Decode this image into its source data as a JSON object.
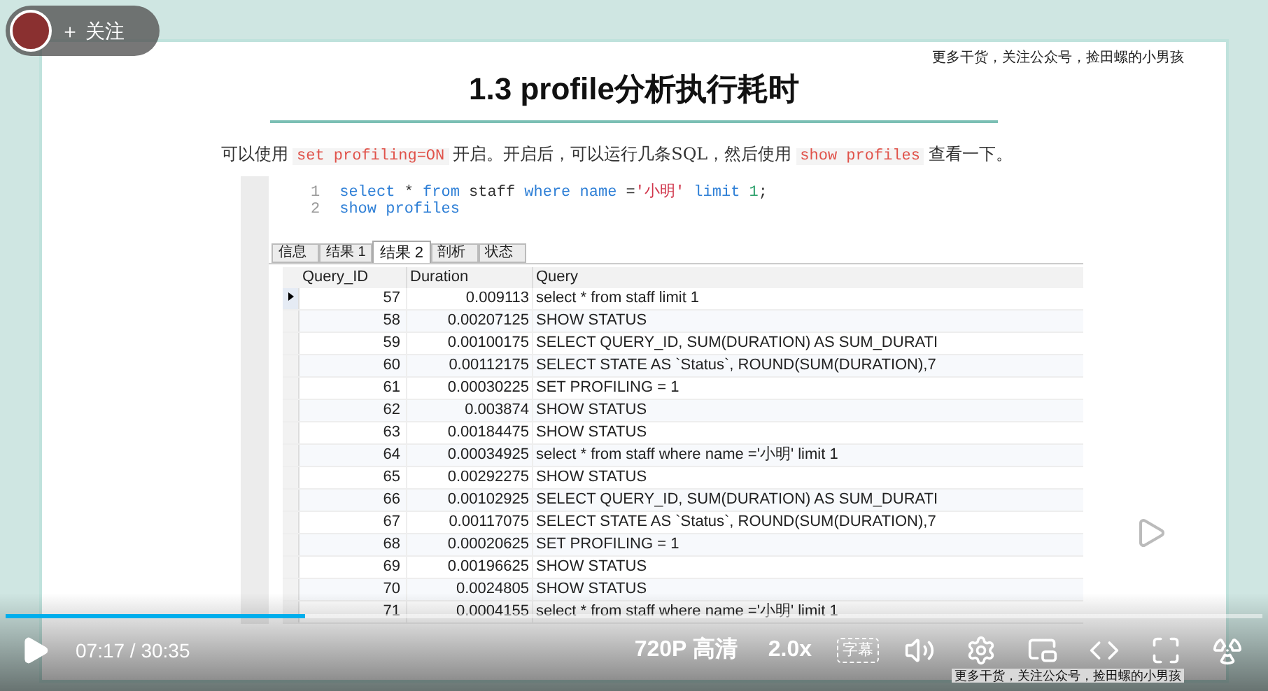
{
  "follow_button": {
    "label": "＋ 关注"
  },
  "slide": {
    "title": "1.3 profile分析执行耗时",
    "header_note": "更多干货，关注公众号，捡田螺的小男孩",
    "paragraph": [
      {
        "kind": "text",
        "text": "可以使用"
      },
      {
        "kind": "code",
        "text": "set profiling=ON"
      },
      {
        "kind": "text",
        "text": "开启。开启后，可以运行几条SQL，然后使用"
      },
      {
        "kind": "code",
        "text": "show profiles"
      },
      {
        "kind": "text",
        "text": "查看一下。"
      }
    ],
    "editor": {
      "lines": [
        {
          "number": "1",
          "tokens": [
            {
              "kind": "keyword",
              "text": "select"
            },
            {
              "kind": "plain",
              "text": " * "
            },
            {
              "kind": "keyword",
              "text": "from"
            },
            {
              "kind": "plain",
              "text": " staff "
            },
            {
              "kind": "keyword",
              "text": "where name"
            },
            {
              "kind": "plain",
              "text": " ="
            },
            {
              "kind": "string",
              "text": "'小明'"
            },
            {
              "kind": "keyword",
              "text": " limit "
            },
            {
              "kind": "number",
              "text": "1"
            },
            {
              "kind": "plain",
              "text": ";"
            }
          ]
        },
        {
          "number": "2",
          "tokens": [
            {
              "kind": "keyword",
              "text": "show profiles"
            }
          ]
        }
      ]
    },
    "tabs": [
      {
        "label": "信息",
        "selected": false
      },
      {
        "label": "结果 1",
        "selected": false
      },
      {
        "label": "结果 2",
        "selected": true
      },
      {
        "label": "剖析",
        "selected": false
      },
      {
        "label": "状态",
        "selected": false
      }
    ],
    "table": {
      "columns": [
        "Query_ID",
        "Duration",
        "Query"
      ],
      "rows": [
        {
          "selected": true,
          "cells": [
            "57",
            "0.009113",
            "select * from staff limit 1"
          ]
        },
        {
          "selected": false,
          "cells": [
            "58",
            "0.00207125",
            "SHOW STATUS"
          ]
        },
        {
          "selected": false,
          "cells": [
            "59",
            "0.00100175",
            "SELECT QUERY_ID, SUM(DURATION) AS SUM_DURATI"
          ]
        },
        {
          "selected": false,
          "cells": [
            "60",
            "0.00112175",
            "SELECT STATE AS `Status`, ROUND(SUM(DURATION),7"
          ]
        },
        {
          "selected": false,
          "cells": [
            "61",
            "0.00030225",
            "SET PROFILING = 1"
          ]
        },
        {
          "selected": false,
          "cells": [
            "62",
            "0.003874",
            "SHOW STATUS"
          ]
        },
        {
          "selected": false,
          "cells": [
            "63",
            "0.00184475",
            "SHOW STATUS"
          ]
        },
        {
          "selected": false,
          "cells": [
            "64",
            "0.00034925",
            "select * from staff where name ='小明' limit 1"
          ]
        },
        {
          "selected": false,
          "cells": [
            "65",
            "0.00292275",
            "SHOW STATUS"
          ]
        },
        {
          "selected": false,
          "cells": [
            "66",
            "0.00102925",
            "SELECT QUERY_ID, SUM(DURATION) AS SUM_DURATI"
          ]
        },
        {
          "selected": false,
          "cells": [
            "67",
            "0.00117075",
            "SELECT STATE AS `Status`, ROUND(SUM(DURATION),7"
          ]
        },
        {
          "selected": false,
          "cells": [
            "68",
            "0.00020625",
            "SET PROFILING = 1"
          ]
        },
        {
          "selected": false,
          "cells": [
            "69",
            "0.00196625",
            "SHOW STATUS"
          ]
        },
        {
          "selected": false,
          "cells": [
            "70",
            "0.0024805",
            "SHOW STATUS"
          ]
        },
        {
          "selected": false,
          "cells": [
            "71",
            "0.0004155",
            "select * from staff where name ='小明' limit 1"
          ]
        }
      ]
    },
    "footer_note": "更多干货，关注公众号，捡田螺的小男孩"
  },
  "player": {
    "progress": {
      "level": 0.238
    },
    "current_time": "07:17",
    "separator": "/",
    "total_time": "30:35",
    "quality": "720P 高清",
    "speed": "2.0x",
    "subtitles": {
      "label": "字幕",
      "on": false
    }
  }
}
